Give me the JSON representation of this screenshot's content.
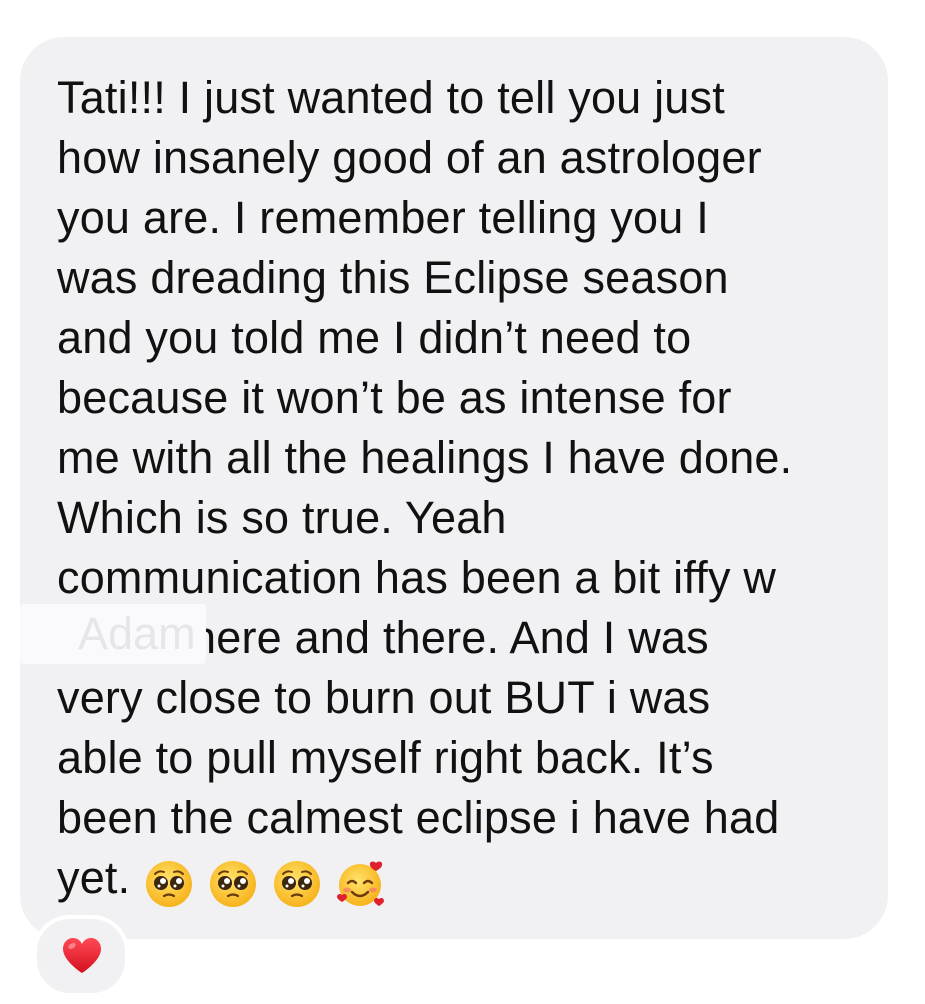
{
  "message": {
    "lines": [
      "Tati!!! I just wanted to tell you just",
      "how insanely good of an astrologer",
      "you are. I remember telling you I",
      "was dreading this Eclipse season",
      "and you told me I didn’t need to",
      "because it won’t be as intense for",
      "me with all the healings I have done.",
      "Which is so true. Yeah",
      "communication has been a bit iffy w",
      "here and there. And I was",
      "very close to burn out BUT i was",
      "able to pull myself right back. It’s",
      "been the calmest eclipse i have had",
      "yet."
    ],
    "redacted_name": "Adam",
    "emojis": [
      "pleading-face-icon",
      "pleading-face-icon",
      "pleading-face-icon",
      "smiling-face-with-hearts-icon"
    ]
  },
  "reaction": {
    "icon": "red-heart-icon",
    "color": "#e0202e"
  },
  "colors": {
    "bubble": "#f1f1f3",
    "text": "#111111"
  }
}
